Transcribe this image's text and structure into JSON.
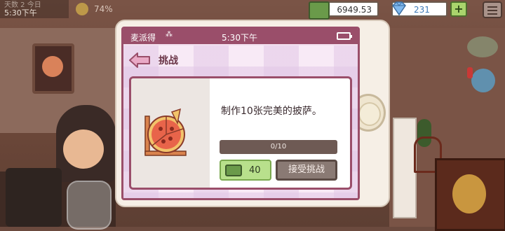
{
  "hud": {
    "time_top": "天数 2 今日",
    "time": "5:30下午",
    "mood_percent": "74%",
    "cash": "6949.53",
    "gems": "231",
    "add_label": "+",
    "cash_icon": "cash-icon",
    "gem_icon": "diamond-icon"
  },
  "phone": {
    "status": {
      "carrier": "麦派得",
      "time": "5:30下午"
    },
    "page_title": "挑战",
    "challenge": {
      "description": "制作10张完美的披萨。",
      "progress_label": "0/10",
      "progress_value": 0,
      "progress_max": 10,
      "reward_amount": "40",
      "accept_label": "接受挑战",
      "image_icon": "pizza-slice-ruler-icon"
    }
  },
  "colors": {
    "accent": "#9a4e6a",
    "reward_green": "#b8e08c",
    "button_gray": "#8a7a74"
  }
}
